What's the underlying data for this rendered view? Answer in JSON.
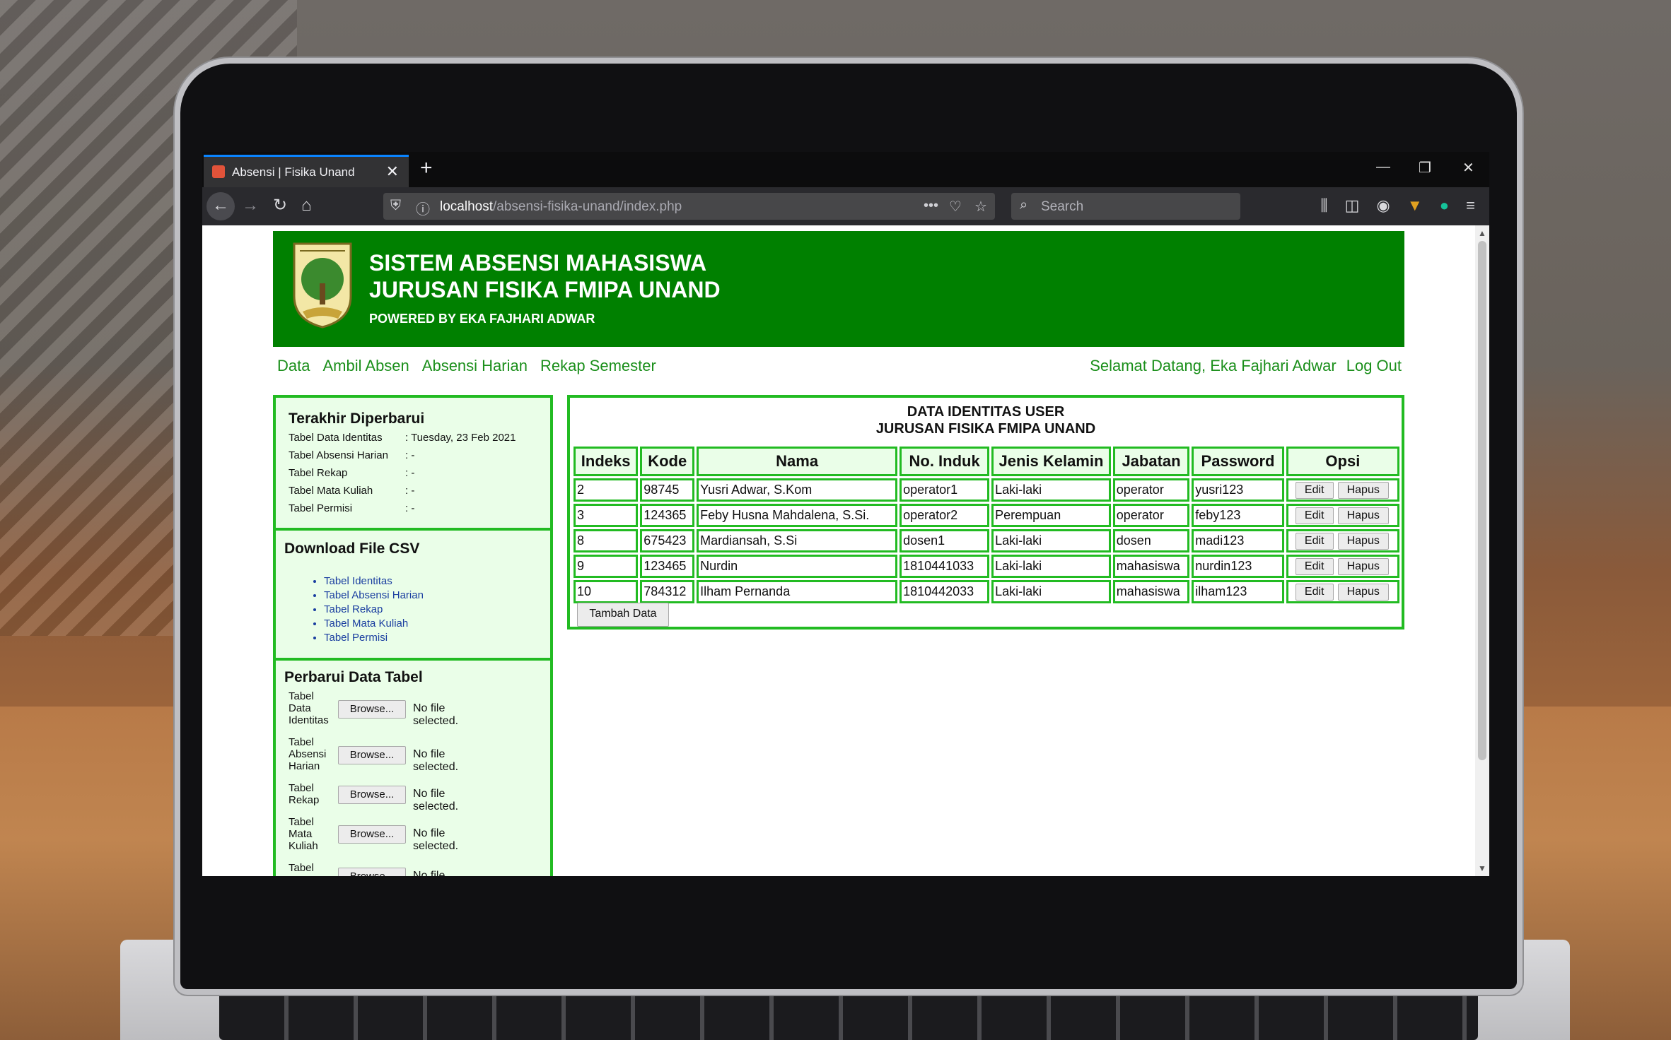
{
  "browser": {
    "tab_title": "Absensi | Fisika Unand",
    "url_host": "localhost",
    "url_path": "/absensi-fisika-unand/index.php",
    "search_placeholder": "Search"
  },
  "header": {
    "title_line1": "SISTEM ABSENSI MAHASISWA",
    "title_line2": "JURUSAN FISIKA FMIPA UNAND",
    "subtitle": "POWERED BY EKA FAJHARI ADWAR",
    "color": "#008000"
  },
  "menu": {
    "items": [
      "Data",
      "Ambil Absen",
      "Absensi Harian",
      "Rekap Semester"
    ],
    "welcome": "Selamat Datang, Eka Fajhari Adwar",
    "logout": "Log Out"
  },
  "last_updated": {
    "heading": "Terakhir Diperbarui",
    "rows": [
      {
        "label": "Tabel Data Identitas",
        "value": ": Tuesday, 23 Feb 2021"
      },
      {
        "label": "Tabel Absensi Harian",
        "value": ": -"
      },
      {
        "label": "Tabel Rekap",
        "value": ": -"
      },
      {
        "label": "Tabel Mata Kuliah",
        "value": ": -"
      },
      {
        "label": "Tabel Permisi",
        "value": ": -"
      }
    ]
  },
  "download": {
    "heading": "Download File CSV",
    "links": [
      "Tabel Identitas",
      "Tabel Absensi Harian",
      "Tabel Rekap",
      "Tabel Mata Kuliah",
      "Tabel Permisi"
    ]
  },
  "update": {
    "heading": "Perbarui Data Tabel",
    "browse_label": "Browse...",
    "no_file": "No file selected.",
    "rows": [
      {
        "label": "Tabel Data Identitas"
      },
      {
        "label": "Tabel Absensi Harian"
      },
      {
        "label": "Tabel Rekap"
      },
      {
        "label": "Tabel Mata Kuliah"
      },
      {
        "label": "Tabel"
      }
    ]
  },
  "main": {
    "title_line1": "DATA IDENTITAS USER",
    "title_line2": "JURUSAN FISIKA FMIPA UNAND",
    "columns": [
      "Indeks",
      "Kode",
      "Nama",
      "No. Induk",
      "Jenis Kelamin",
      "Jabatan",
      "Password",
      "Opsi"
    ],
    "rows": [
      [
        "2",
        "98745",
        "Yusri Adwar, S.Kom",
        "operator1",
        "Laki-laki",
        "operator",
        "yusri123"
      ],
      [
        "3",
        "124365",
        "Feby Husna Mahdalena, S.Si.",
        "operator2",
        "Perempuan",
        "operator",
        "feby123"
      ],
      [
        "8",
        "675423",
        "Mardiansah, S.Si",
        "dosen1",
        "Laki-laki",
        "dosen",
        "madi123"
      ],
      [
        "9",
        "123465",
        "Nurdin",
        "1810441033",
        "Laki-laki",
        "mahasiswa",
        "nurdin123"
      ],
      [
        "10",
        "784312",
        "Ilham Pernanda",
        "1810442033",
        "Laki-laki",
        "mahasiswa",
        "ilham123"
      ]
    ],
    "edit_label": "Edit",
    "delete_label": "Hapus",
    "add_label": "Tambah Data",
    "border_color": "#22bb22"
  }
}
